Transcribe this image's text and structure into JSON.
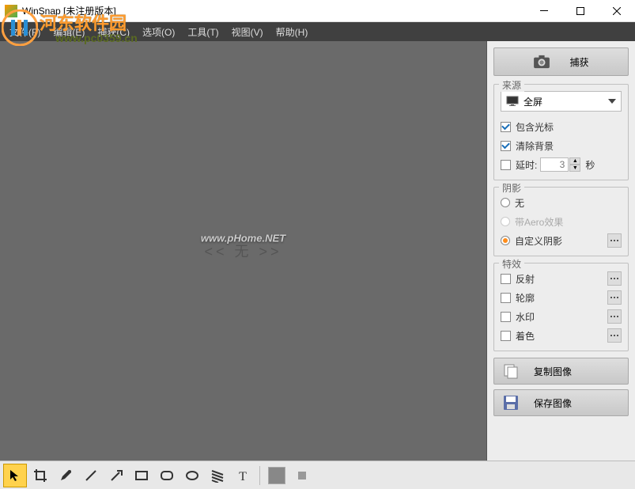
{
  "title": "WinSnap   [未注册版本]",
  "menu": [
    "文件(F)",
    "编辑(E)",
    "捕获(C)",
    "选项(O)",
    "工具(T)",
    "视图(V)",
    "帮助(H)"
  ],
  "watermark": {
    "brand": "河东软件园",
    "url": "www.pc0359.cn"
  },
  "canvas": {
    "placeholder": "<< 无 >>",
    "centermark": "www.pHome.NET"
  },
  "sidebar": {
    "capture": "捕获",
    "source": {
      "title": "来源",
      "fullscreen": "全屏",
      "include_cursor": {
        "label": "包含光标",
        "checked": true
      },
      "clear_bg": {
        "label": "清除背景",
        "checked": true
      },
      "delay": {
        "label": "延时:",
        "checked": false,
        "value": "3",
        "unit": "秒"
      }
    },
    "shadow": {
      "title": "阴影",
      "none": "无",
      "aero": "带Aero效果",
      "custom": "自定义阴影",
      "selected": "custom"
    },
    "effects": {
      "title": "特效",
      "reflect": {
        "label": "反射",
        "checked": false
      },
      "outline": {
        "label": "轮廓",
        "checked": false
      },
      "watermark": {
        "label": "水印",
        "checked": false
      },
      "tint": {
        "label": "着色",
        "checked": false
      }
    },
    "copy": "复制图像",
    "save": "保存图像"
  },
  "tools": [
    "cursor",
    "crop",
    "pen",
    "line",
    "arrow",
    "rect",
    "roundrect",
    "ellipse",
    "blur",
    "text"
  ]
}
